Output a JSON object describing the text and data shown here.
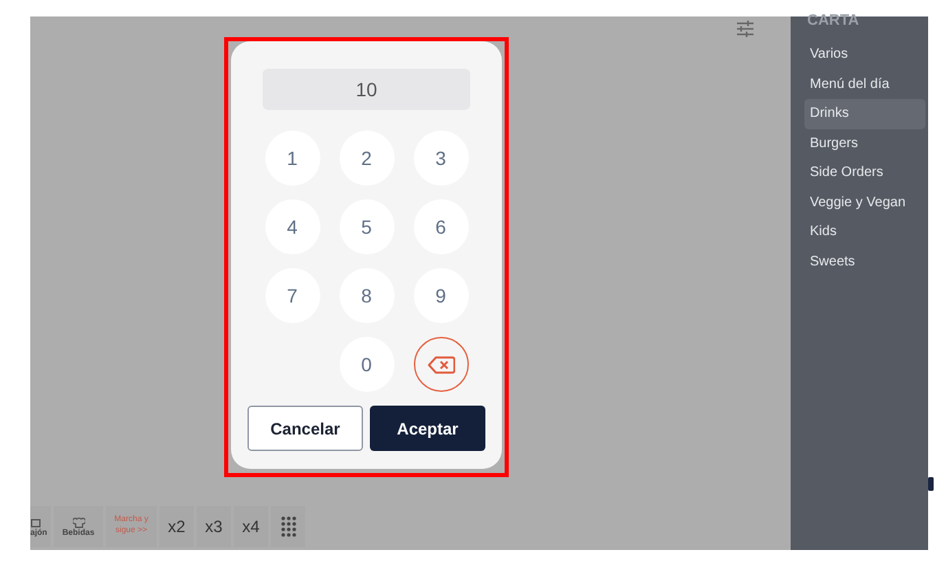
{
  "keypad": {
    "display": "10",
    "keys": [
      {
        "kind": "digit",
        "label": "1"
      },
      {
        "kind": "digit",
        "label": "2"
      },
      {
        "kind": "digit",
        "label": "3"
      },
      {
        "kind": "digit",
        "label": "4"
      },
      {
        "kind": "digit",
        "label": "5"
      },
      {
        "kind": "digit",
        "label": "6"
      },
      {
        "kind": "digit",
        "label": "7"
      },
      {
        "kind": "digit",
        "label": "8"
      },
      {
        "kind": "digit",
        "label": "9"
      },
      {
        "kind": "empty"
      },
      {
        "kind": "digit",
        "label": "0"
      },
      {
        "kind": "backspace"
      }
    ],
    "buttons": [
      {
        "kind": "secondary",
        "label": "Cancelar"
      },
      {
        "kind": "primary",
        "label": "Aceptar"
      }
    ]
  },
  "sidebar": {
    "title": "CARTA",
    "items": [
      {
        "label": "Varios",
        "selected": false
      },
      {
        "label": "Menú del día",
        "selected": false
      },
      {
        "label": "Drinks",
        "selected": true
      },
      {
        "label": "Burgers",
        "selected": false
      },
      {
        "label": "Side Orders",
        "selected": false
      },
      {
        "label": "Veggie y Vegan",
        "selected": false
      },
      {
        "label": "Kids",
        "selected": false
      },
      {
        "label": "Sweets",
        "selected": false
      }
    ]
  },
  "toolbar": [
    {
      "kind": "drawer",
      "label": "ajón"
    },
    {
      "kind": "chef",
      "label": "Bebidas"
    },
    {
      "kind": "accent",
      "label": "Marcha y sigue >>"
    },
    {
      "kind": "text",
      "label": "x2"
    },
    {
      "kind": "text",
      "label": "x3"
    },
    {
      "kind": "text",
      "label": "x4"
    },
    {
      "kind": "keypad-icon"
    }
  ]
}
